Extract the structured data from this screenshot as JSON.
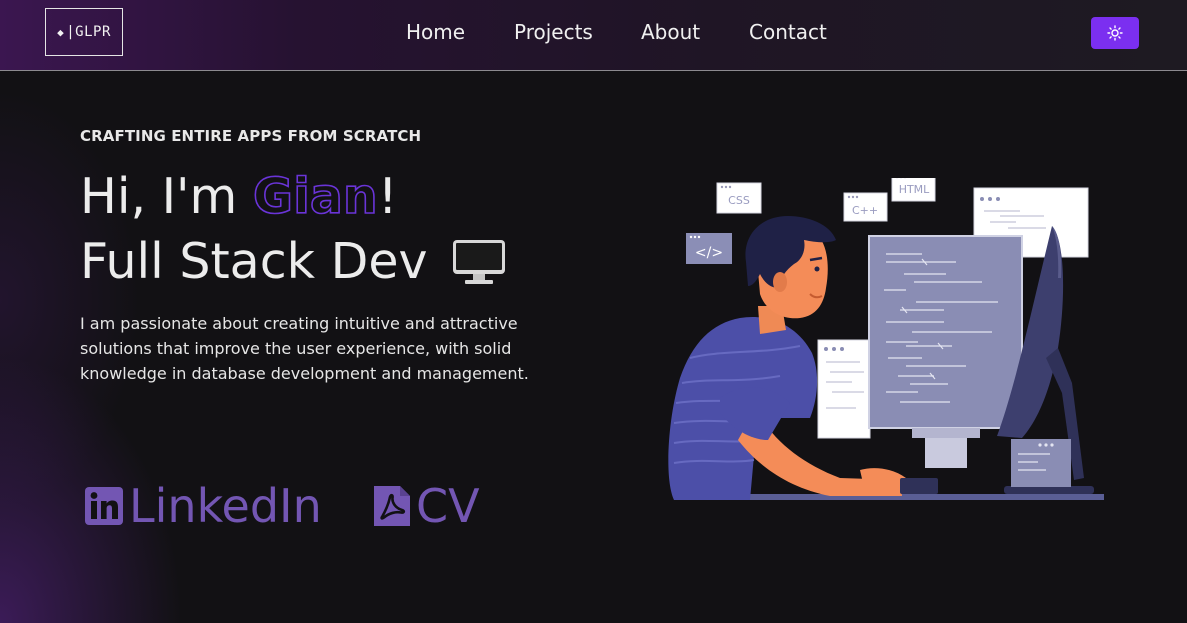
{
  "header": {
    "logo": {
      "symbol": "◆",
      "text": "|GLPR"
    },
    "nav": [
      {
        "label": "Home"
      },
      {
        "label": "Projects"
      },
      {
        "label": "About"
      },
      {
        "label": "Contact"
      }
    ],
    "theme_toggle": {
      "icon": "sun-icon",
      "color": "#7b2ff0"
    }
  },
  "hero": {
    "eyebrow": "CRAFTING ENTIRE APPS FROM SCRATCH",
    "greeting_prefix": "Hi, I'm ",
    "name": "Gian",
    "greeting_suffix": "!",
    "role": "Full Stack Dev",
    "role_icon": "desktop-computer-icon",
    "description": "I am passionate about creating intuitive and attractive solutions that improve the user experience, with solid knowledge in database development and management.",
    "links": [
      {
        "label": "LinkedIn",
        "icon": "linkedin-icon"
      },
      {
        "label": "CV",
        "icon": "pdf-file-icon"
      }
    ],
    "illustration": {
      "tags": [
        "CSS",
        "C++",
        "HTML",
        "</>"
      ]
    }
  },
  "colors": {
    "accent": "#7b2ff0",
    "name_outline": "#6a34d8",
    "link": "#7356b3",
    "background": "#121114"
  }
}
